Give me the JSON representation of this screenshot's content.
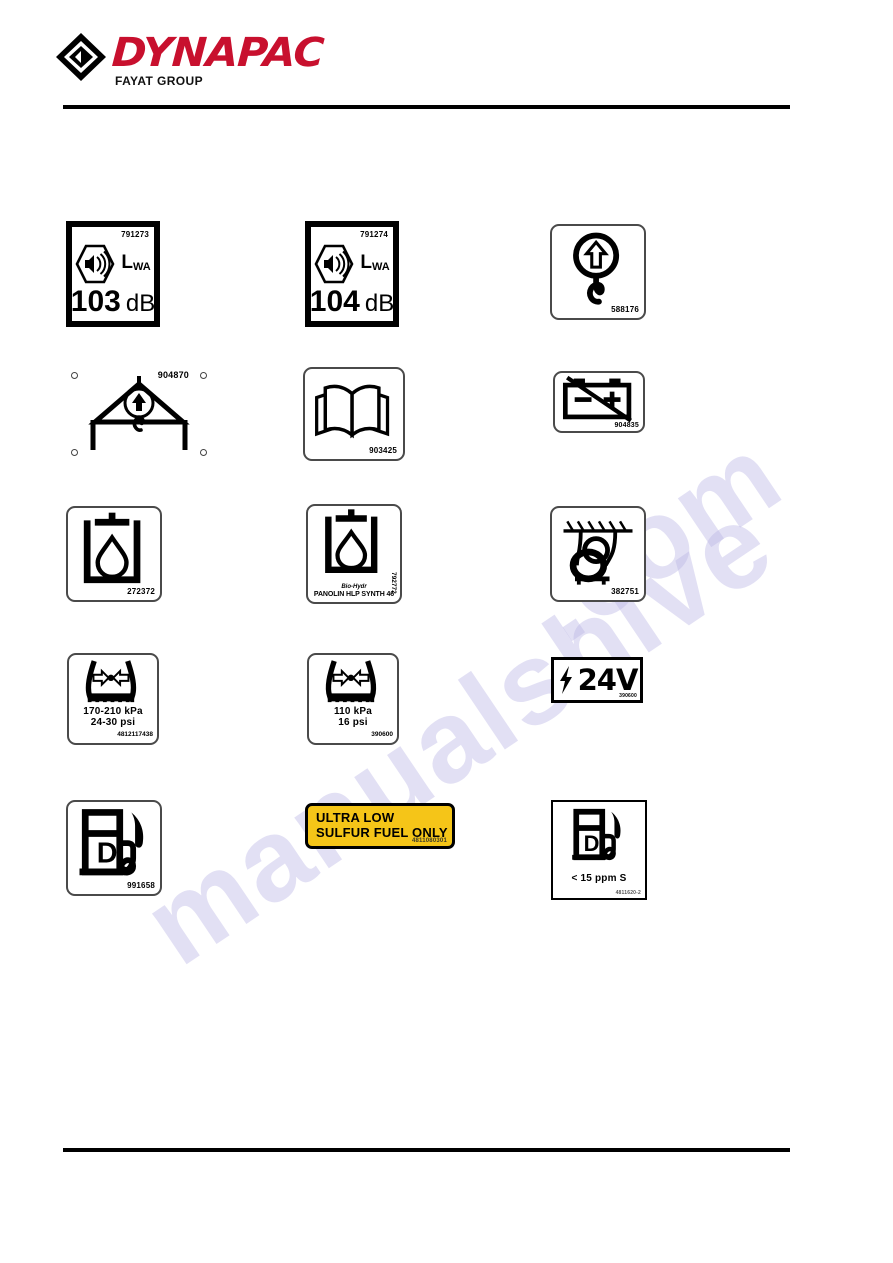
{
  "brand": {
    "name": "DYNAPAC",
    "group": "FAYAT GROUP",
    "accent_color": "#c8102e",
    "logo_icon": "dynapac-diamond-logo"
  },
  "watermark": {
    "text": "manualshive.com",
    "part_a": "manualshive",
    "part_b": ".com",
    "color": "#b9b4e4"
  },
  "decals": {
    "noise_103": {
      "code": "791273",
      "lwa_label": "L",
      "lwa_sub": "WA",
      "value": "103",
      "unit": "dB",
      "icon": "speaker-hex-icon"
    },
    "noise_104": {
      "code": "791274",
      "lwa_label": "L",
      "lwa_sub": "WA",
      "value": "104",
      "unit": "dB",
      "icon": "speaker-hex-icon"
    },
    "lifting_hook": {
      "code": "588176",
      "icon": "lifting-hook-arrow-icon"
    },
    "lifting_sling": {
      "code": "904870",
      "icon": "lifting-sling-icon"
    },
    "read_manual": {
      "code": "903425",
      "icon": "open-book-icon"
    },
    "battery_disconnect": {
      "code": "904835",
      "icon": "battery-crossed-icon",
      "minus": "–",
      "plus": "+"
    },
    "hydraulic_oil": {
      "code": "272372",
      "icon": "oil-droplet-tank-icon"
    },
    "bio_hydraulic_oil": {
      "code": "792772",
      "caption_line1": "Bio-Hydr",
      "caption_line2": "PANOLIN HLP SYNTH 46",
      "icon": "oil-droplet-tank-icon"
    },
    "lashing_point": {
      "code": "382751",
      "icon": "lashing-tiedown-icon"
    },
    "tyre_pressure_high": {
      "code": "4812117438",
      "kpa": "170-210 kPa",
      "psi": "24-30   psi",
      "icon": "tyre-pressure-icon"
    },
    "tyre_pressure_low": {
      "code": "390600",
      "kpa": "110 kPa",
      "psi": "16  psi",
      "icon": "tyre-pressure-icon"
    },
    "voltage_24v": {
      "code": "390600",
      "value": "24V",
      "icon": "lightning-bolt-icon"
    },
    "diesel_fuel": {
      "code": "991658",
      "pump_letter": "D",
      "icon": "diesel-pump-icon"
    },
    "ultra_low_sulfur": {
      "code": "4811080301",
      "line1": "ULTRA LOW",
      "line2": "SULFUR FUEL ONLY",
      "background_color": "#f5c518"
    },
    "diesel_ppm": {
      "code": "4811620-2",
      "pump_letter": "D",
      "spec": "< 15 ppm S",
      "icon": "diesel-pump-icon"
    }
  }
}
